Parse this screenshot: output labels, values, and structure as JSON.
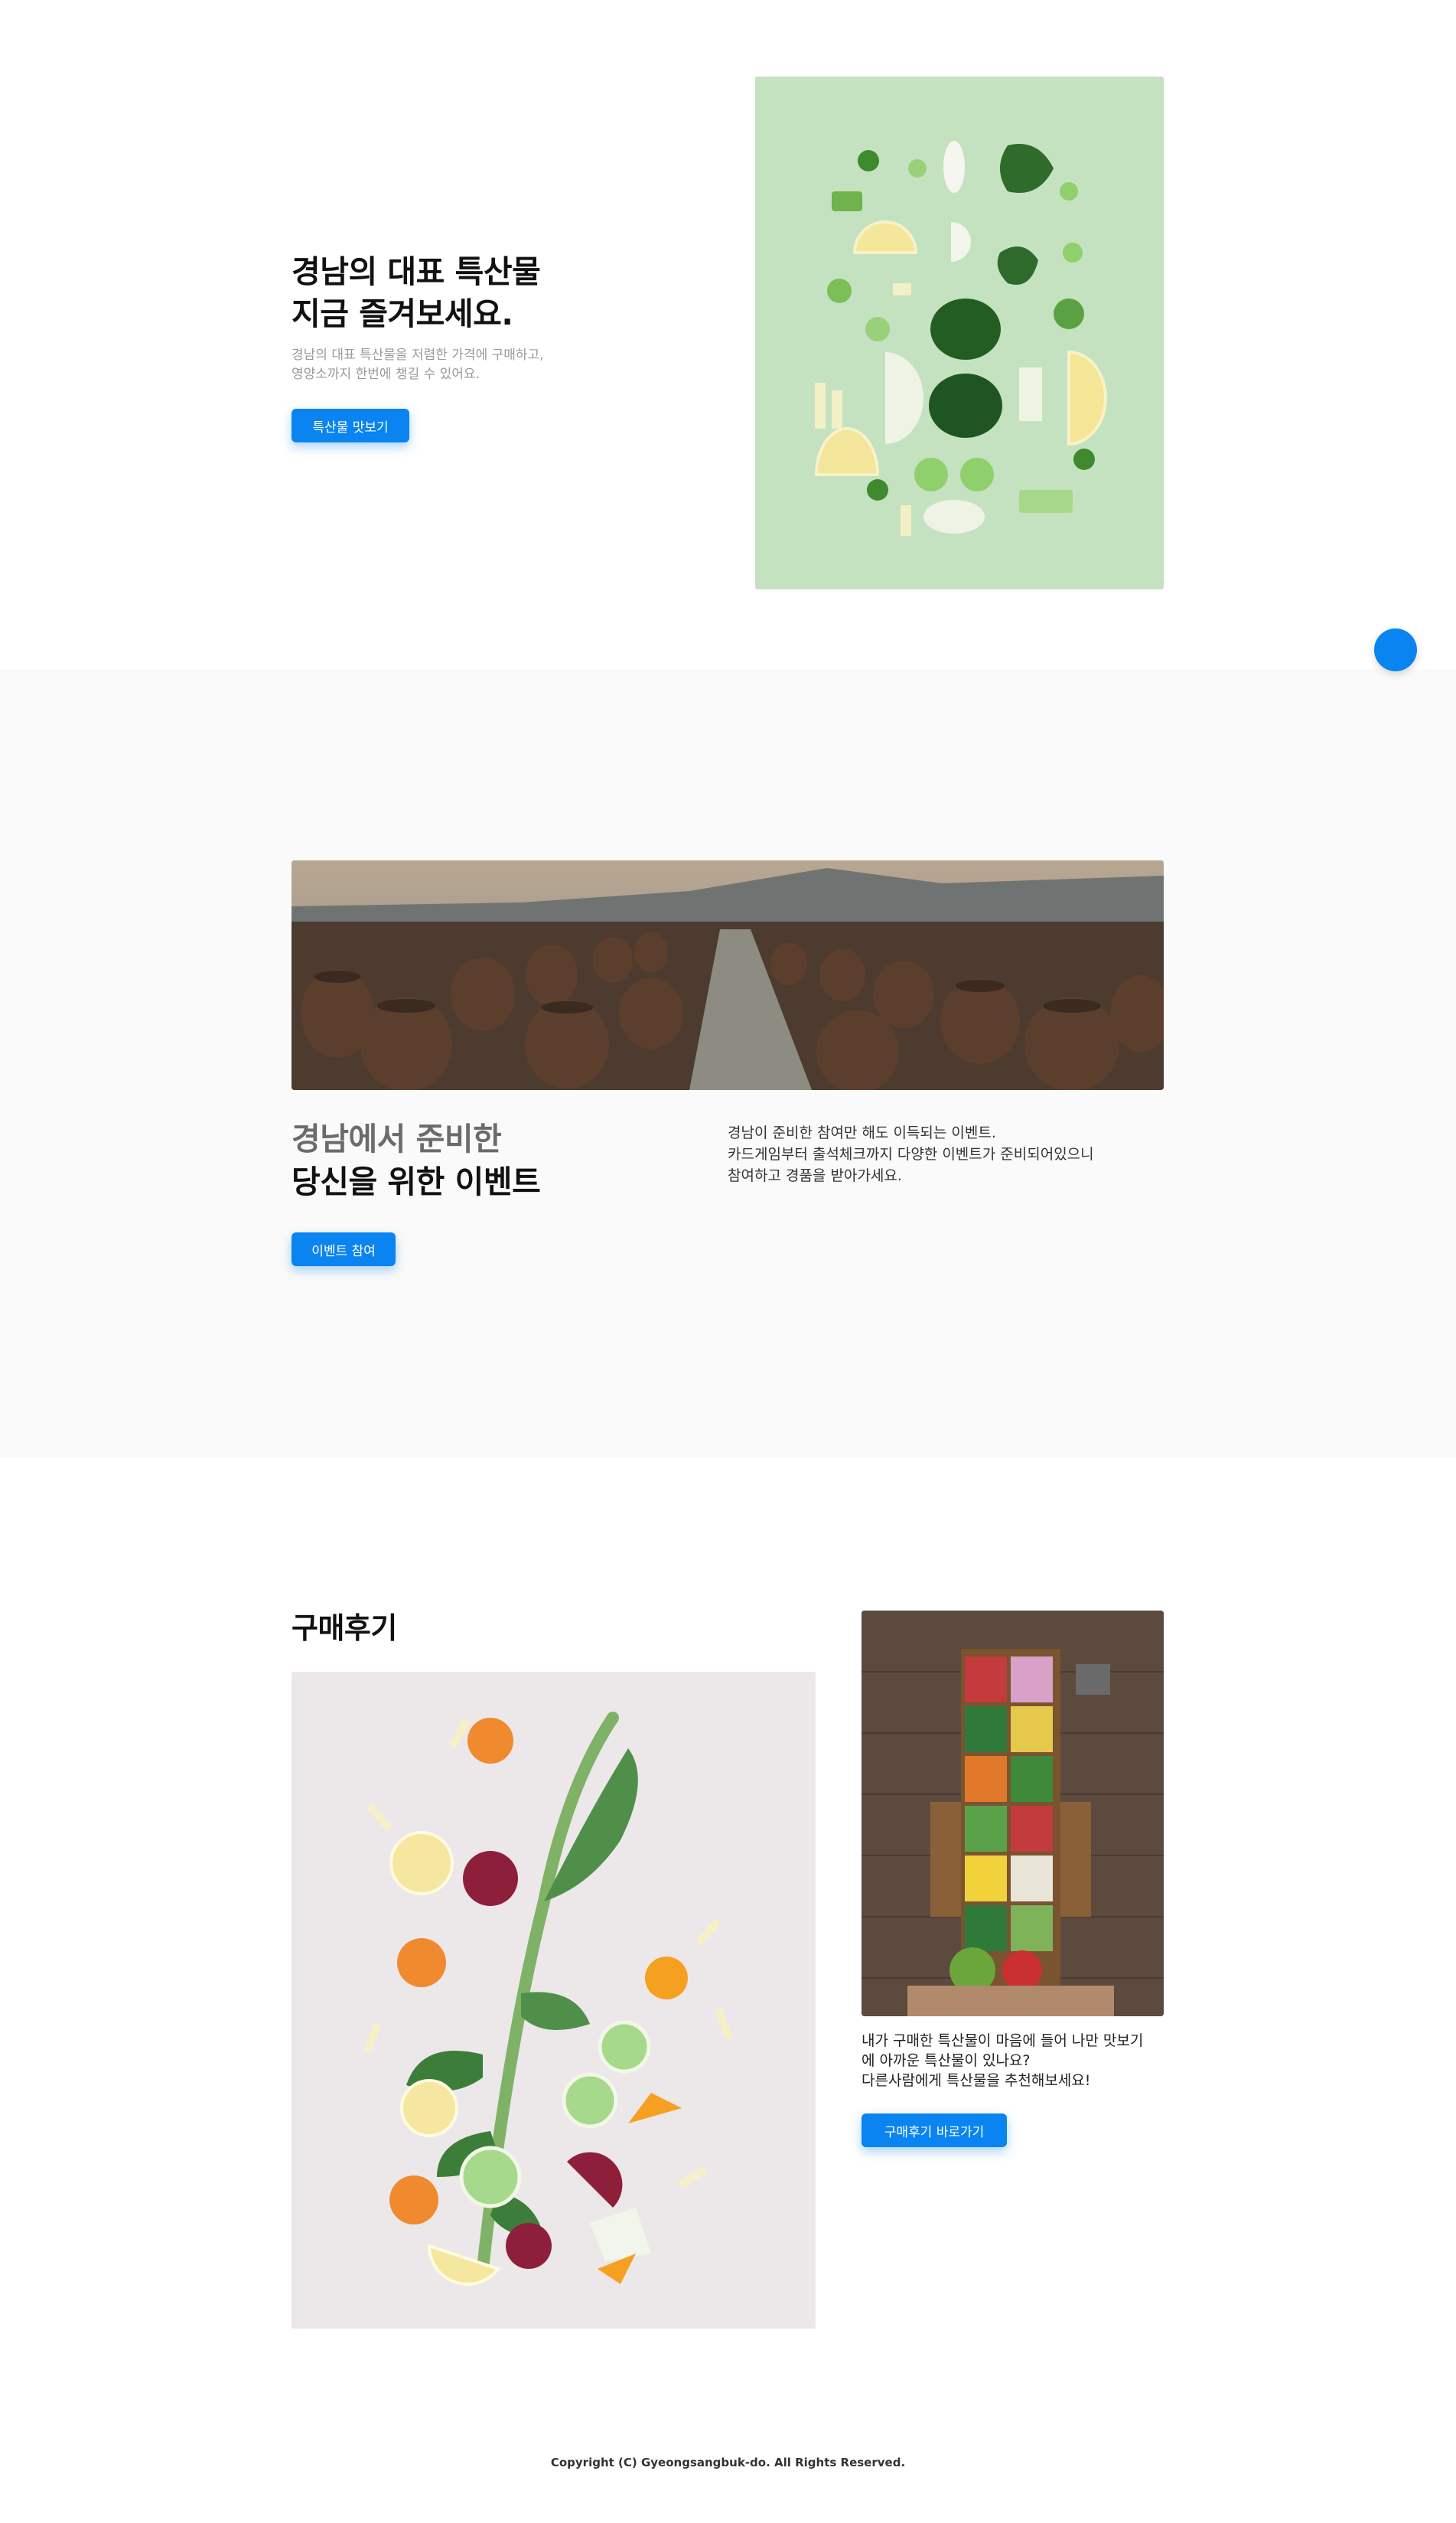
{
  "hero": {
    "title_line1": "경남의 대표 특산물",
    "title_line2": "지금 즐겨보세요.",
    "desc_line1": "경남의 대표 특산물을 저렴한 가격에 구매하고,",
    "desc_line2": "영양소까지 한번에 챙길 수 있어요.",
    "button_label": "특산물 맛보기",
    "image_icon": "vegetables-flatlay-image"
  },
  "event": {
    "title_line1": "경남에서 준비한",
    "title_line2": "당신을 위한 이벤트",
    "desc_line1": "경남이 준비한 참여만 해도 이득되는 이벤트.",
    "desc_line2": "카드게임부터 출석체크까지 다양한 이벤트가 준비되어있으니",
    "desc_line3": "참여하고 경품을 받아가세요.",
    "button_label": "이벤트 참여",
    "banner_icon": "onggi-jars-image"
  },
  "review": {
    "title": "구매후기",
    "desc_line1": "내가 구매한 특산물이 마음에 들어 나만 맛보기",
    "desc_line2": "에 아까운 특산물이 있나요?",
    "desc_line3": "다른사람에게 특산물을 추천해보세요!",
    "button_label": "구매후기 바로가기",
    "main_image_icon": "kale-vegetables-image",
    "side_image_icon": "market-stall-image"
  },
  "footer": {
    "copyright": "Copyright (C) Gyeongsangbuk-do. All Rights Reserved."
  },
  "colors": {
    "accent": "#0a84f0",
    "event_bg": "#fafafa",
    "hero_image_bg": "#c4e2c0"
  },
  "floating_button_icon": "floating-action-button"
}
